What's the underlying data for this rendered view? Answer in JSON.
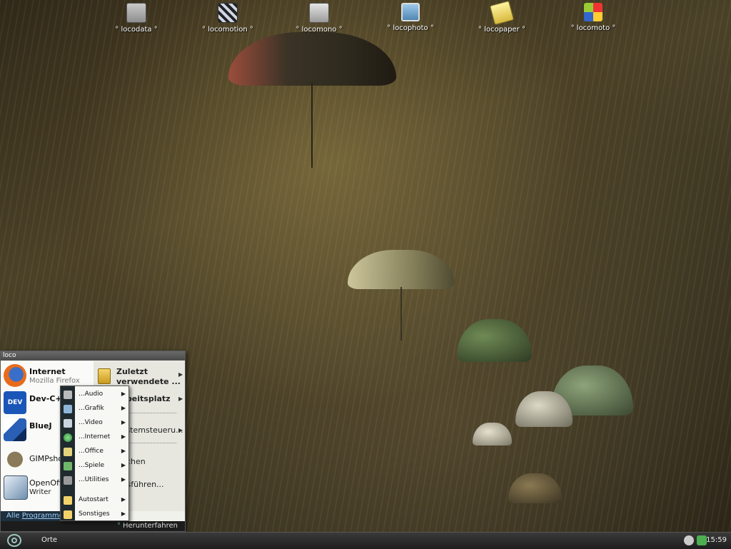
{
  "desktop": {
    "icons": [
      {
        "label": "° locodata °",
        "icon": "floppy-icon"
      },
      {
        "label": "° locomotion °",
        "icon": "film-icon"
      },
      {
        "label": "° locomono °",
        "icon": "speaker-icon"
      },
      {
        "label": "° locophoto °",
        "icon": "photo-icon"
      },
      {
        "label": "° locopaper °",
        "icon": "notepad-icon"
      },
      {
        "label": "° locomoto °",
        "icon": "cubes-icon"
      }
    ]
  },
  "start_menu": {
    "title": "loco",
    "pinned": [
      {
        "name": "Internet",
        "sub": "Mozilla Firefox",
        "icon": "firefox-icon"
      },
      {
        "name": "Dev-C++",
        "sub": "",
        "icon": "devcpp-icon"
      },
      {
        "name": "BlueJ",
        "sub": "",
        "icon": "bluej-icon"
      },
      {
        "name": "GIMPshop",
        "sub": "",
        "icon": "gimp-icon"
      },
      {
        "name": "OpenOffice",
        "sub": "Writer",
        "icon": "writer-icon"
      }
    ],
    "all_programs_prefix": "Alle ",
    "all_programs_link": "Programme",
    "right": {
      "recent_line1": "Zuletzt",
      "recent_line2": "verwendete ...",
      "workspace": "Arbeitsplatz",
      "control_panel": "Systemsteueru...",
      "search": "Suchen",
      "run": "Ausführen..."
    },
    "shutdown": "Herunterfahren"
  },
  "submenu": {
    "items": [
      {
        "label": "...Audio",
        "icon": "audio-icon"
      },
      {
        "label": "...Grafik",
        "icon": "graphics-icon"
      },
      {
        "label": "...Video",
        "icon": "video-icon"
      },
      {
        "label": "...Internet",
        "icon": "globe-icon"
      },
      {
        "label": "...Office",
        "icon": "office-icon"
      },
      {
        "label": "...Spiele",
        "icon": "games-icon"
      },
      {
        "label": "...Utilities",
        "icon": "utilities-icon"
      },
      {
        "label": "Autostart",
        "icon": "folder-icon"
      },
      {
        "label": "Sonstiges",
        "icon": "folder-icon"
      }
    ]
  },
  "taskbar": {
    "places": "Orte",
    "clock": "15:59"
  }
}
